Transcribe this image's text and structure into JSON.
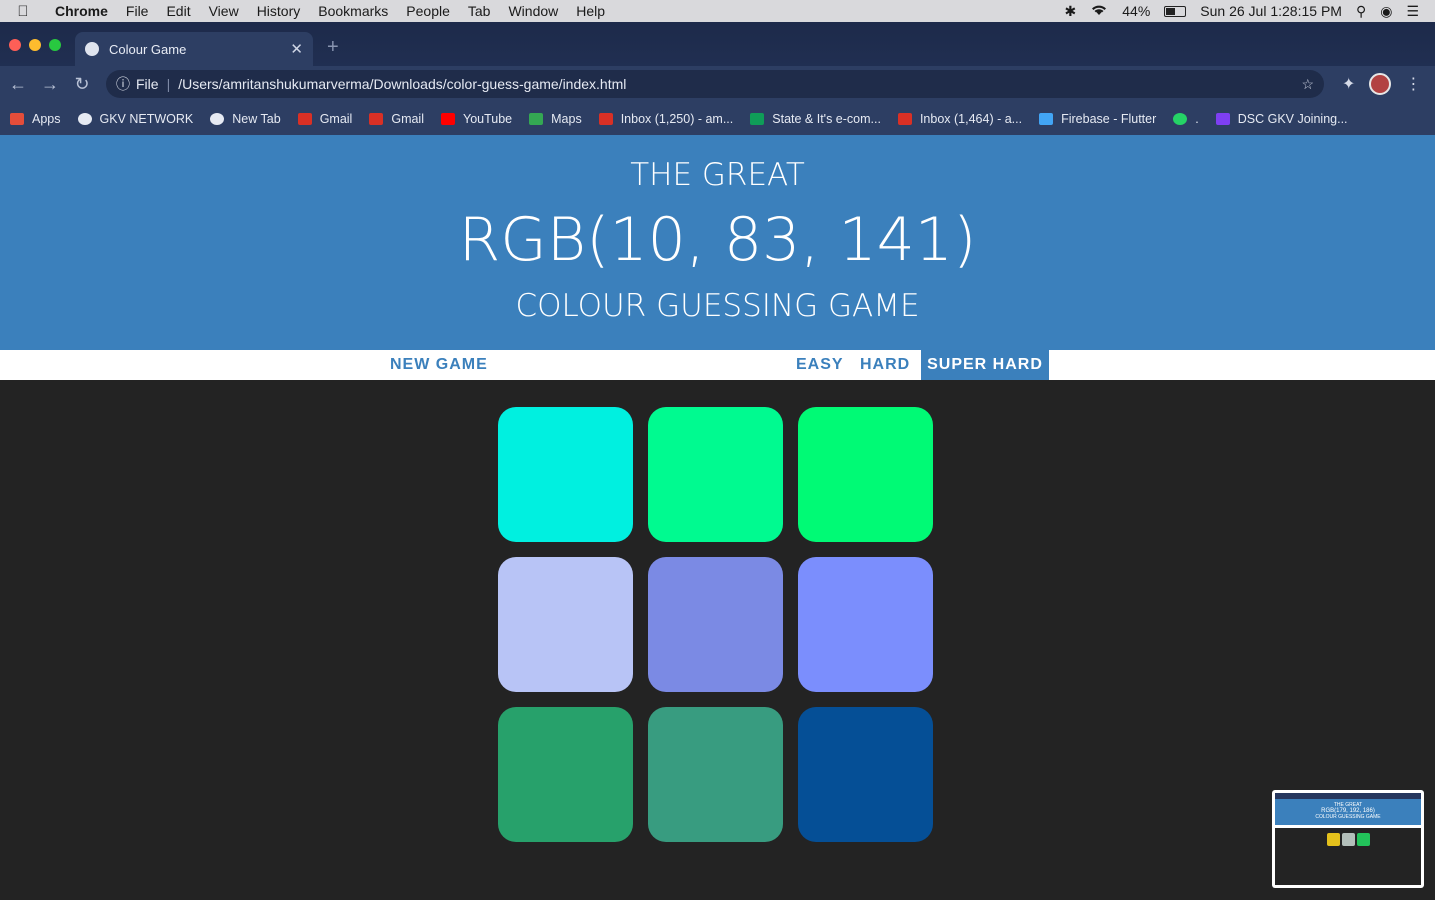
{
  "menubar": {
    "app_name": "Chrome",
    "items": [
      "File",
      "Edit",
      "View",
      "History",
      "Bookmarks",
      "People",
      "Tab",
      "Window",
      "Help"
    ],
    "battery": "44%",
    "datetime": "Sun 26 Jul  1:28:15 PM"
  },
  "browser": {
    "tab_title": "Colour Game",
    "url_scheme_label": "File",
    "url": "/Users/amritanshukumarverma/Downloads/color-guess-game/index.html",
    "bookmarks": [
      {
        "label": "Apps",
        "icon": "apps-grid-icon",
        "color": "#e44d3a"
      },
      {
        "label": "GKV NETWORK",
        "icon": "globe-icon",
        "color": "#e6eaf3"
      },
      {
        "label": "New Tab",
        "icon": "globe-icon",
        "color": "#e6eaf3"
      },
      {
        "label": "Gmail",
        "icon": "gmail-icon",
        "color": "#d93025"
      },
      {
        "label": "Gmail",
        "icon": "gmail-icon",
        "color": "#d93025"
      },
      {
        "label": "YouTube",
        "icon": "youtube-icon",
        "color": "#ff0000"
      },
      {
        "label": "Maps",
        "icon": "maps-icon",
        "color": "#34a853"
      },
      {
        "label": "Inbox (1,250) - am...",
        "icon": "gmail-icon",
        "color": "#d93025"
      },
      {
        "label": "State & It's e-com...",
        "icon": "sheets-icon",
        "color": "#0f9d58"
      },
      {
        "label": "Inbox (1,464) - a...",
        "icon": "gmail-icon",
        "color": "#d93025"
      },
      {
        "label": "Firebase - Flutter",
        "icon": "flutter-icon",
        "color": "#42a5f5"
      },
      {
        "label": ".",
        "icon": "whatsapp-icon",
        "color": "#25d366"
      },
      {
        "label": "DSC GKV Joining...",
        "icon": "forms-icon",
        "color": "#7e3ff2"
      }
    ]
  },
  "game": {
    "title_top": "THE GREAT",
    "rgb_display": "RGB(10, 83, 141)",
    "title_bottom": "COLOUR GUESSING GAME",
    "buttons": {
      "new_game": "NEW GAME",
      "easy": "EASY",
      "hard": "HARD",
      "super_hard": "SUPER HARD"
    },
    "selected_mode": "super_hard",
    "squares": [
      "#00f0e0",
      "#00fa90",
      "#00fa75",
      "#b8c4f6",
      "#7b8ae4",
      "#7b8efd",
      "#27a16b",
      "#389c80",
      "#054f96"
    ]
  },
  "thumbnail": {
    "title_top": "THE GREAT",
    "rgb_display": "RGB(179, 192, 186)",
    "title_bottom": "COLOUR GUESSING GAME",
    "squares": [
      "#e4c11c",
      "#b3bfba",
      "#22c35a"
    ]
  },
  "colors": {
    "header_blue": "#3b80bc",
    "page_background": "#232323"
  }
}
